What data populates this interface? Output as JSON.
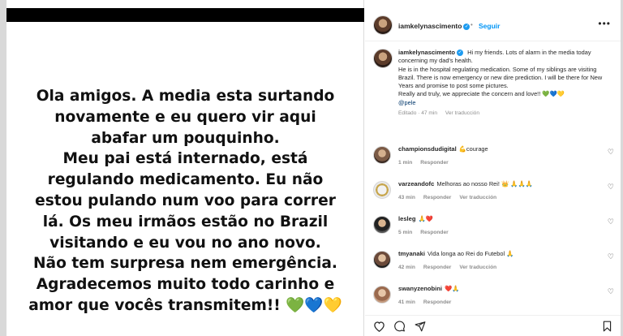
{
  "story": {
    "lines": [
      "Ola amigos. A media esta surtando",
      "novamente e eu quero vir aqui",
      "abafar um pouquinho.",
      "Meu pai está internado, está",
      "regulando medicamento. Eu não",
      "estou pulando num voo para correr",
      "lá. Os meu irmãos estão no Brazil",
      "visitando e eu vou no ano novo.",
      "Não tem surpresa nem emergência.",
      "Agradecemos muito todo carinho e",
      "amor que vocês transmitem!!"
    ],
    "hearts": "💚💙💛"
  },
  "header": {
    "username": "iamkelynascimento",
    "dot": "•",
    "follow_label": "Seguir",
    "more_label": "•••"
  },
  "caption": {
    "username": "iamkelynascimento",
    "text": "Hi my friends. Lots of alarm in the media today concerning my dad's health.",
    "text2": "He is in the hospital regulating medication. Some of my siblings are visiting Brazil. There is now emergency or new dire prediction. I will be there for New Years and promise to post some pictures.",
    "text3": "Really and truly, we appreciate the concern and love!! 💚💙💛",
    "mention": "@pele",
    "edited": "Editado · 47 min",
    "translate": "Ver traducción"
  },
  "comments": [
    {
      "username": "championsdudigital",
      "text": "💪courage",
      "time": "1 min",
      "reply": "Responder",
      "translate": ""
    },
    {
      "username": "varzeandofc",
      "text": "Melhoras ao nosso Rei! 👑 🙏🙏🙏",
      "time": "43 min",
      "reply": "Responder",
      "translate": "Ver traducción"
    },
    {
      "username": "lesleg",
      "text": "🙏❤️",
      "time": "5 min",
      "reply": "Responder",
      "translate": ""
    },
    {
      "username": "tmyanaki",
      "text": "Vida longa ao Rei do Futebol 🙏",
      "time": "42 min",
      "reply": "Responder",
      "translate": "Ver traducción"
    },
    {
      "username": "swanyzenobini",
      "text": "❤️🙏",
      "time": "41 min",
      "reply": "Responder",
      "translate": ""
    }
  ],
  "icons": {
    "heart": "heart-icon",
    "comment": "comment-icon",
    "share": "share-icon",
    "save": "bookmark-icon"
  }
}
